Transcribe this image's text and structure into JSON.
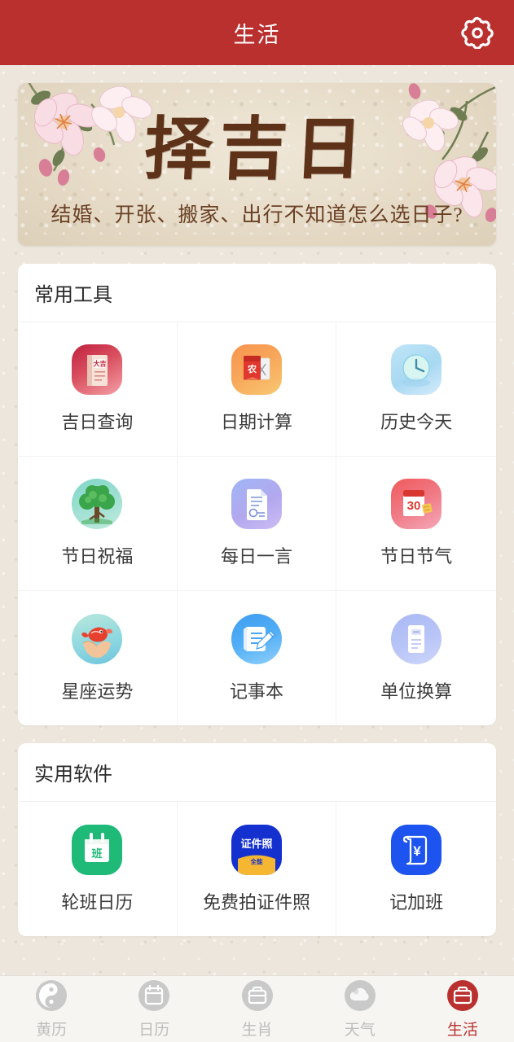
{
  "header": {
    "title": "生活",
    "settings_icon": "gear-icon"
  },
  "banner": {
    "title": "择吉日",
    "subtitle": "结婚、开张、搬家、出行不知道怎么选日子?",
    "decor": "cherry-blossom"
  },
  "sections": [
    {
      "title": "常用工具",
      "items": [
        {
          "label": "吉日查询",
          "icon": "auspicious-day-book-icon",
          "icon_text": "大吉"
        },
        {
          "label": "日期计算",
          "icon": "date-calculator-icon",
          "icon_text": "农"
        },
        {
          "label": "历史今天",
          "icon": "history-clock-icon",
          "icon_text": ""
        },
        {
          "label": "节日祝福",
          "icon": "festival-blessing-tree-icon",
          "icon_text": ""
        },
        {
          "label": "每日一言",
          "icon": "daily-quote-document-icon",
          "icon_text": ""
        },
        {
          "label": "节日节气",
          "icon": "festival-solar-term-calendar-icon",
          "icon_text": "30"
        },
        {
          "label": "星座运势",
          "icon": "horoscope-koi-icon",
          "icon_text": ""
        },
        {
          "label": "记事本",
          "icon": "notepad-pen-icon",
          "icon_text": ""
        },
        {
          "label": "单位换算",
          "icon": "unit-conversion-icon",
          "icon_text": ""
        }
      ]
    },
    {
      "title": "实用软件",
      "items": [
        {
          "label": "轮班日历",
          "icon": "shift-calendar-icon",
          "icon_text": "班"
        },
        {
          "label": "免费拍证件照",
          "icon": "id-photo-icon",
          "icon_text": "证件照",
          "icon_text2": "全能"
        },
        {
          "label": "记加班",
          "icon": "overtime-record-icon",
          "icon_text": "¥"
        }
      ]
    }
  ],
  "tabbar": {
    "active_index": 4,
    "items": [
      {
        "label": "黄历",
        "icon": "yin-yang-icon"
      },
      {
        "label": "日历",
        "icon": "calendar-icon"
      },
      {
        "label": "生肖",
        "icon": "zodiac-briefcase-icon"
      },
      {
        "label": "天气",
        "icon": "cloud-icon"
      },
      {
        "label": "生活",
        "icon": "life-toolbox-icon"
      }
    ]
  },
  "colors": {
    "brand_red": "#b9302f",
    "page_bg": "#ece6dc",
    "card_bg": "#ffffff",
    "tab_inactive": "#bdbdbd"
  }
}
